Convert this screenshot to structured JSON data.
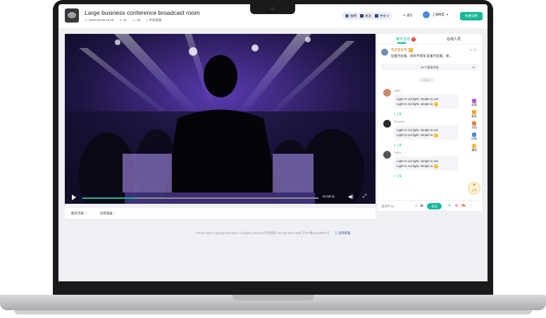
{
  "header": {
    "title": "Large business conference broadcast room",
    "date": "2020-05-09 15:45",
    "viewers": "34",
    "comments": "26",
    "mobile": "手机观看",
    "pill_items": [
      "独特",
      "关注",
      "中文"
    ],
    "share_label": "送礼",
    "user_name": "上海网友",
    "trial_button": "免费试用"
  },
  "video": {
    "time": "01:55:11",
    "progress": 0.22
  },
  "below_video": {
    "tabs": [
      "图文内容 ›",
      "问卷调查 ›"
    ]
  },
  "footer": {
    "copyright": "©2016-2021 Copyright Bonwee, All rights reserved.所有版权 Tel:400-000-1588 沪ICP备13026007号",
    "feedback": "反馈邮箱"
  },
  "chat": {
    "tabs": [
      "聊天互动",
      "在线人员"
    ],
    "badge_count": "3",
    "pinned": {
      "name": "我是面板我",
      "tag": "主",
      "time": "11:35",
      "message": "轻重不轻重、简单不简单,轻重不轻重、简..."
    },
    "notice": "40个重推消息",
    "time_separator": "10:23",
    "messages": [
      {
        "name": "Jade",
        "line1": "Light is not light, simple is not",
        "line2": "Light is not light, simple is",
        "likes": "5 上条",
        "avatar_color": "#c98a6a"
      },
      {
        "name": "Chynna",
        "line1": "Light is not light, simple is not",
        "line2": "Light is not light, simple is",
        "likes": "5 上条",
        "avatar_color": "#2a2a2a"
      },
      {
        "name": "haha",
        "line1": "Light is not light, simple is not",
        "line2": "Light is not light, simple is",
        "likes": "5 上条",
        "avatar_color": "#555555"
      }
    ],
    "side_tools": [
      "投票",
      "抽奖",
      "文档",
      "问卷",
      "通知"
    ],
    "gift_label": "礼物",
    "input_placeholder": "说点什么...",
    "send_label": "发送"
  },
  "colors": {
    "accent": "#16b99a",
    "brand": "#4a5aa8"
  }
}
